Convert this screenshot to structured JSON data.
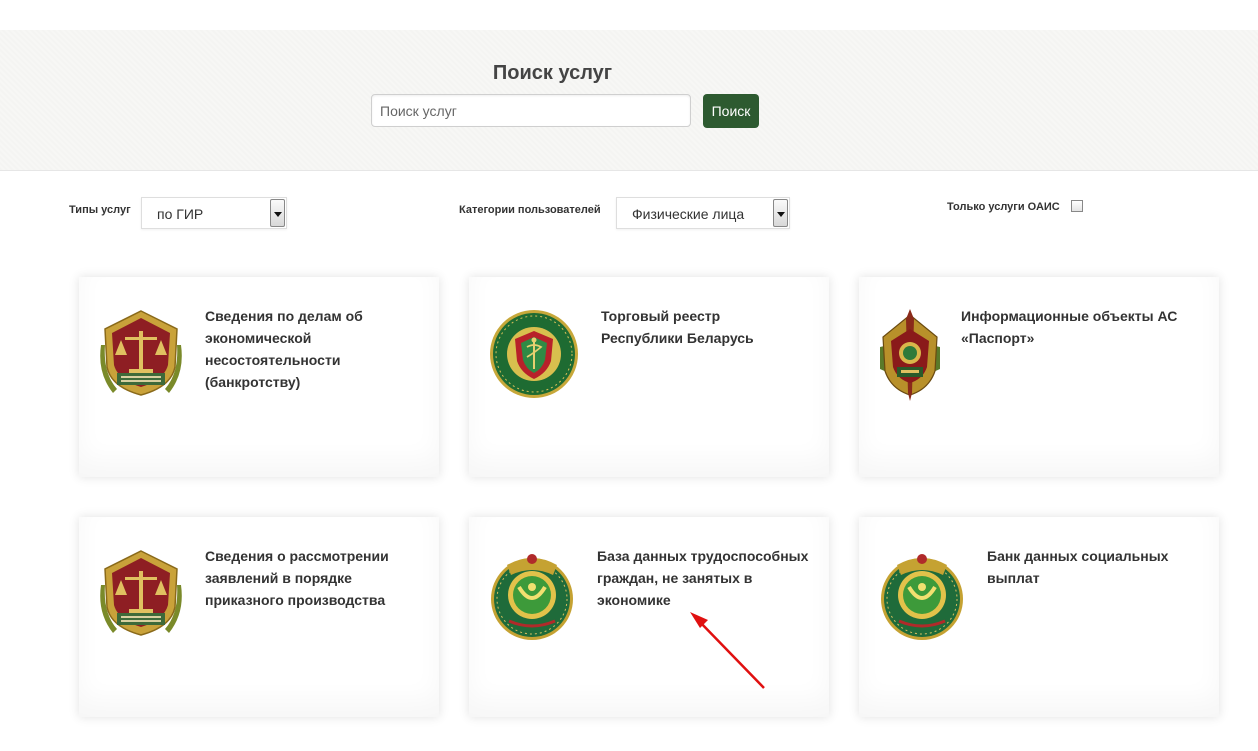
{
  "search": {
    "title": "Поиск услуг",
    "placeholder": "Поиск услуг",
    "button_label": "Поиск"
  },
  "filters": {
    "service_types_label": "Типы услуг",
    "service_types_value": "по ГИР",
    "user_categories_label": "Категории пользователей",
    "user_categories_value": "Физические лица",
    "oais_only_label": "Только услуги ОАИС",
    "oais_only_checked": false
  },
  "cards": [
    {
      "title": "Сведения по делам об экономической несостоятельности (банкротству)",
      "emblem": "supreme-court-emblem"
    },
    {
      "title": "Торговый реестр Республики Беларусь",
      "emblem": "ministry-trade-emblem"
    },
    {
      "title": "Информационные объекты АС «Паспорт»",
      "emblem": "mvd-emblem"
    },
    {
      "title": "Сведения о рассмотрении заявлений в порядке приказного производства",
      "emblem": "supreme-court-emblem"
    },
    {
      "title": "База данных трудоспособных граждан, не занятых в экономике",
      "emblem": "ministry-labour-emblem"
    },
    {
      "title": "Банк данных социальных выплат",
      "emblem": "ministry-labour-emblem"
    }
  ],
  "colors": {
    "button": "#2d5a30",
    "annotation_arrow": "#e01010"
  }
}
